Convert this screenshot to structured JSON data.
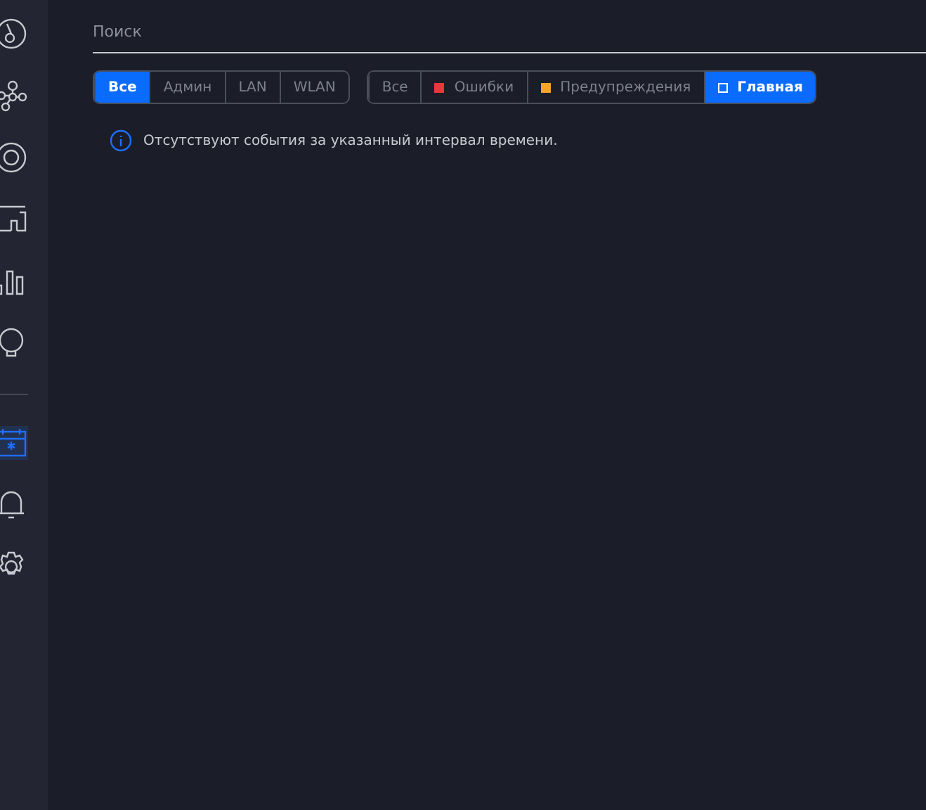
{
  "sidebar": {
    "top_items": [
      {
        "selected": false
      },
      {
        "selected": false
      },
      {
        "selected": false
      },
      {
        "selected": false
      },
      {
        "selected": false
      },
      {
        "selected": false
      }
    ],
    "bottom_items": [
      {
        "selected": true
      },
      {
        "selected": false
      },
      {
        "selected": false
      }
    ]
  },
  "search": {
    "placeholder": "Поиск"
  },
  "source_filter": [
    {
      "label": "Все",
      "selected": true
    },
    {
      "label": "Админ",
      "selected": false
    },
    {
      "label": "LAN",
      "selected": false
    },
    {
      "label": "WLAN",
      "selected": false
    }
  ],
  "level_filter": [
    {
      "label": "Все",
      "selected": false
    },
    {
      "label": "Ошибки",
      "selected": false,
      "color": "#e8383d"
    },
    {
      "label": "Предупреждения",
      "selected": false,
      "color": "#f5a623"
    },
    {
      "label": "Главная",
      "selected": true,
      "color": "#ffffff"
    }
  ],
  "message": "Отсутствуют события за указанный интервал времени."
}
